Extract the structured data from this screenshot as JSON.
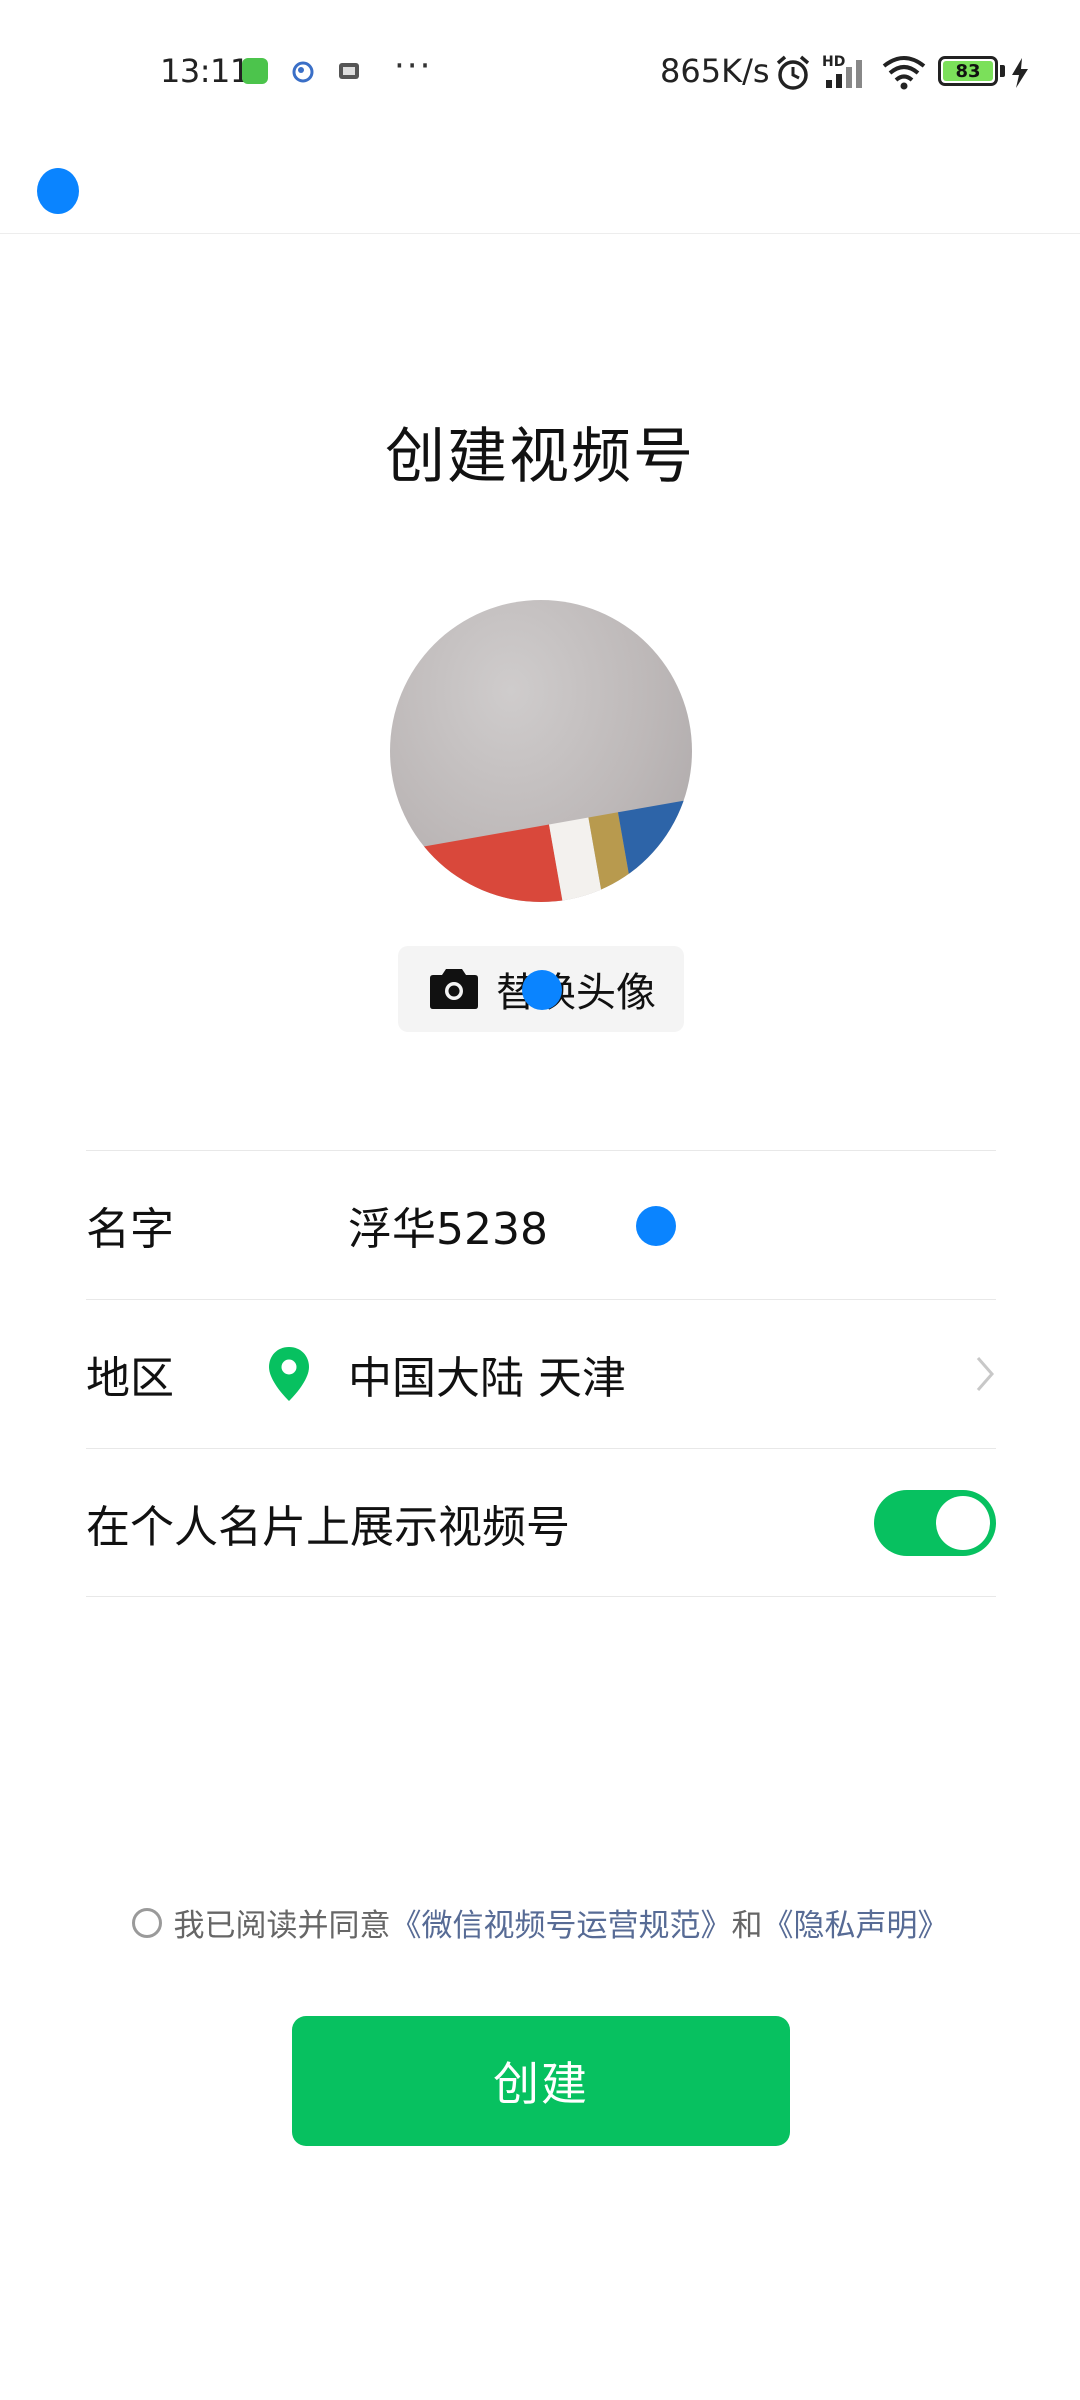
{
  "status_bar": {
    "time": "13:11",
    "more_dots": "···",
    "net_speed": "865K/s",
    "hd_label": "HD",
    "battery_level": "83",
    "icons": [
      "wechat-app-icon",
      "app-icon",
      "app-icon",
      "alarm-icon",
      "signal-icon",
      "wifi-icon",
      "battery-icon",
      "charging-icon"
    ]
  },
  "page": {
    "title": "创建视频号",
    "change_avatar_label": "替换头像"
  },
  "form": {
    "name_label": "名字",
    "name_value": "浮华5238",
    "region_label": "地区",
    "region_value": "中国大陆 天津",
    "show_on_card_label": "在个人名片上展示视频号",
    "show_on_card_enabled": true
  },
  "agreement": {
    "prefix": "我已阅读并同意",
    "link1": "《微信视频号运营规范》",
    "conjunction": "和",
    "link2": "《隐私声明》",
    "checked": false
  },
  "create_button_label": "创建",
  "colors": {
    "accent_green": "#07c160",
    "link_blue": "#576b95",
    "touch_indicator": "#0a84ff"
  }
}
